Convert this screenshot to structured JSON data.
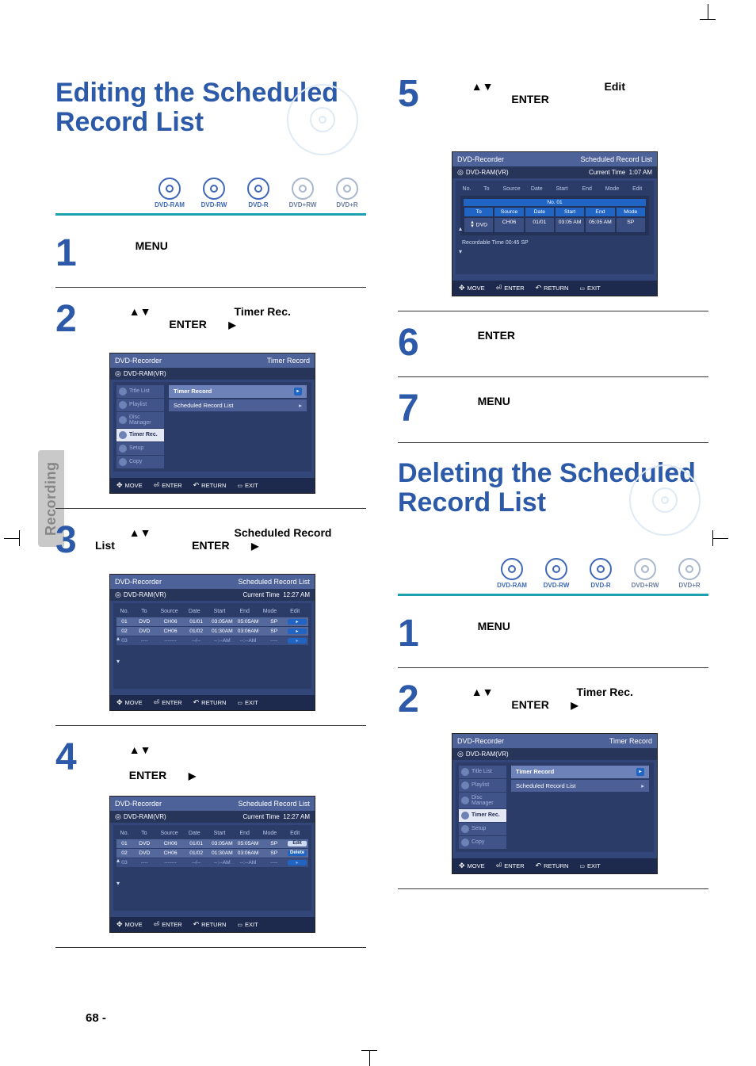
{
  "sidetab_label": "Recording",
  "page_number": "68 -",
  "discs": {
    "items": [
      {
        "label": "DVD-RAM",
        "active": true
      },
      {
        "label": "DVD-RW",
        "active": true
      },
      {
        "label": "DVD-R",
        "active": true
      },
      {
        "label": "DVD+RW",
        "active": false
      },
      {
        "label": "DVD+R",
        "active": false
      }
    ]
  },
  "left": {
    "heading": "Editing the Scheduled Record List",
    "s1": {
      "num": "1",
      "text_b": "MENU"
    },
    "s2": {
      "num": "2",
      "arrow": "▲▼",
      "text_b": "Timer Rec.",
      "enter": "ENTER",
      "tri": "▶"
    },
    "s3": {
      "num": "3",
      "arrow": "▲▼",
      "text_b": "Scheduled Record",
      "post": "List",
      "enter": "ENTER",
      "tri": "▶"
    },
    "s4": {
      "num": "4",
      "arrow": "▲▼",
      "enter": "ENTER",
      "tri": "▶"
    }
  },
  "right": {
    "s5": {
      "num": "5",
      "arrow": "▲▼",
      "text_b": "Edit",
      "enter": "ENTER"
    },
    "s6": {
      "num": "6",
      "text_b": "ENTER"
    },
    "s7": {
      "num": "7",
      "text_b": "MENU"
    },
    "heading2": "Deleting the Scheduled Record List",
    "r1": {
      "num": "1",
      "text_b": "MENU"
    },
    "r2": {
      "num": "2",
      "arrow": "▲▼",
      "text_b": "Timer Rec.",
      "enter": "ENTER",
      "tri": "▶"
    }
  },
  "osd_common": {
    "footbar": {
      "move": "MOVE",
      "enter": "ENTER",
      "ret": "RETURN",
      "exit": "EXIT"
    },
    "app": "DVD-Recorder",
    "disc": "DVD-RAM(VR)"
  },
  "osd_timer_menu": {
    "corner": "Timer Record",
    "menu": [
      "Title List",
      "Playlist",
      "Disc Manager",
      "Timer Rec.",
      "Setup",
      "Copy"
    ],
    "sel_index": 3,
    "sub": [
      "Timer Record",
      "Scheduled Record List"
    ]
  },
  "osd_table": {
    "corner": "Scheduled Record List",
    "time_lbl": "Current Time",
    "time_val": "12:27 AM",
    "cols": [
      "No.",
      "To",
      "Source",
      "Date",
      "Start",
      "End",
      "Mode",
      "Edit"
    ],
    "rows": [
      {
        "no": "01",
        "to": "DVD",
        "src": "CH06",
        "date": "01/01",
        "start": "03:05AM",
        "end": "05:05AM",
        "mode": "SP"
      },
      {
        "no": "02",
        "to": "DVD",
        "src": "CH06",
        "date": "01/02",
        "start": "01:30AM",
        "end": "03:06AM",
        "mode": "SP"
      },
      {
        "no": "03",
        "to": "----",
        "src": "-------",
        "date": "--/--",
        "start": "--:--AM",
        "end": "--:--AM",
        "mode": "----"
      }
    ]
  },
  "osd_table2": {
    "popup": [
      "Edit",
      "Delete"
    ]
  },
  "osd_edit": {
    "corner": "Scheduled Record List",
    "time_lbl": "Current Time",
    "time_val": "1:07 AM",
    "cols": [
      "No.",
      "To",
      "Source",
      "Date",
      "Start",
      "End",
      "Mode",
      "Edit"
    ],
    "no_hdr": "No. 01",
    "caps": [
      "To",
      "Source",
      "Date",
      "Start",
      "End",
      "Mode"
    ],
    "vals": [
      "DVD",
      "CH06",
      "01/01",
      "03:05 AM",
      "05:05 AM",
      "SP"
    ],
    "rec": "Recordable Time   00:45   SP"
  }
}
